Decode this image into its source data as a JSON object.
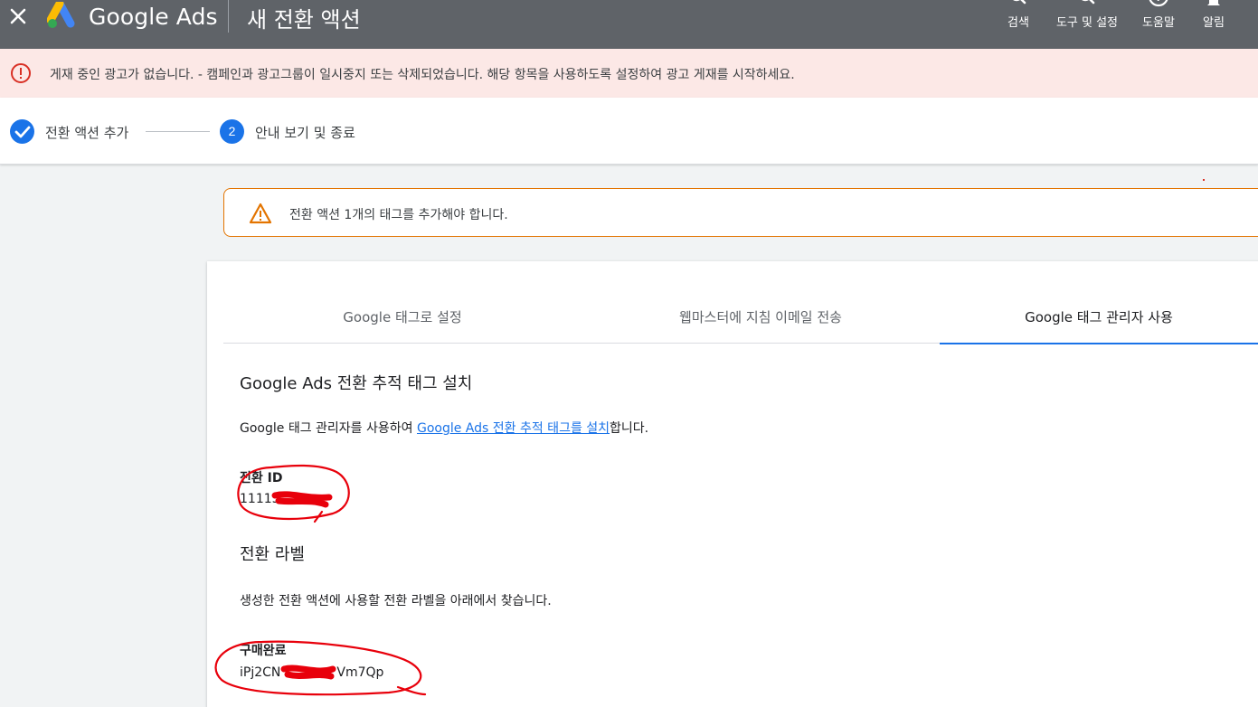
{
  "header": {
    "brand": "Google Ads",
    "page_title": "새 전환 액션",
    "actions": [
      {
        "label": "검색",
        "icon": "search-icon"
      },
      {
        "label": "도구 및 설정",
        "icon": "wrench-icon"
      },
      {
        "label": "도움말",
        "icon": "help-icon"
      },
      {
        "label": "알림",
        "icon": "bell-icon"
      }
    ]
  },
  "alert": {
    "text": "게재 중인 광고가 없습니다. - 캠페인과 광고그룹이 일시중지 또는 삭제되었습니다. 해당 항목을 사용하도록 설정하여 광고 게재를 시작하세요.",
    "color": "#d93025"
  },
  "stepper": {
    "steps": [
      {
        "number": "",
        "label": "전환 액션 추가",
        "state": "completed"
      },
      {
        "number": "2",
        "label": "안내 보기 및 종료",
        "state": "current"
      }
    ]
  },
  "warning": {
    "text": "전환 액션 1개의 태그를 추가해야 합니다.",
    "color": "#e37400"
  },
  "tabs": [
    {
      "label": "Google 태그로 설정"
    },
    {
      "label": "웹마스터에 지침 이메일 전송"
    },
    {
      "label": "Google 태그 관리자 사용",
      "active": true
    }
  ],
  "content": {
    "section_title": "Google Ads 전환 추적 태그 설치",
    "intro_before": "Google 태그 관리자를 사용하여 ",
    "intro_link": "Google Ads 전환 추적 태그를 설치",
    "intro_after": "합니다.",
    "conversion_id_label": "전환 ID",
    "conversion_id_value": "11115",
    "conversion_label_title": "전환 라벨",
    "conversion_label_desc": "생성한 전환 액션에 사용할 전환 라벨을 아래에서 찾습니다.",
    "action_name": "구매완료",
    "label_prefix": "iPj2CN",
    "label_suffix": "Vm7Qp"
  },
  "colors": {
    "accent": "#1a73e8",
    "annotation": "#e8000b"
  }
}
